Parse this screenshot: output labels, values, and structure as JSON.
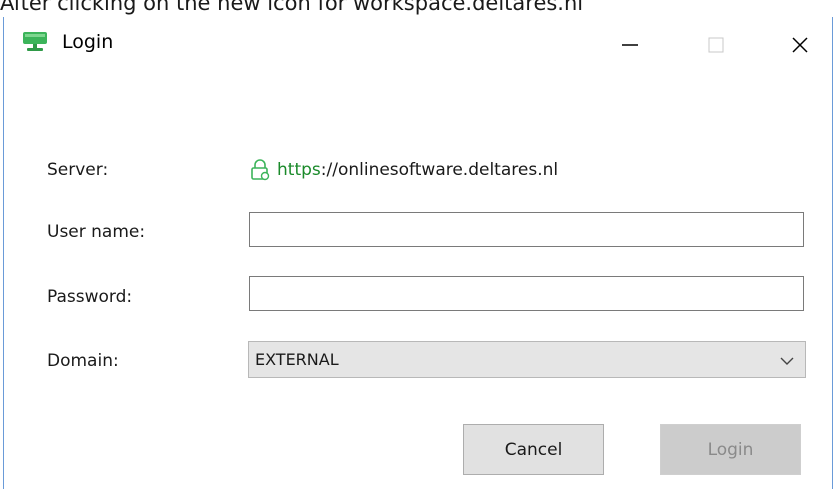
{
  "caption": "After clicking on the new icon for workspace.deltares.nl",
  "window": {
    "title": "Login",
    "minimize_glyph": "—",
    "icons": {
      "app": "monitor-icon",
      "lock": "lock-icon"
    },
    "accent_color": "#1a8a2a"
  },
  "form": {
    "server_label": "Server:",
    "server_scheme": "https",
    "server_rest": "://onlinesoftware.deltares.nl",
    "username_label": "User name:",
    "username_value": "",
    "password_label": "Password:",
    "password_value": "",
    "domain_label": "Domain:",
    "domain_value": "EXTERNAL"
  },
  "buttons": {
    "cancel": "Cancel",
    "login": "Login",
    "login_enabled": false
  }
}
